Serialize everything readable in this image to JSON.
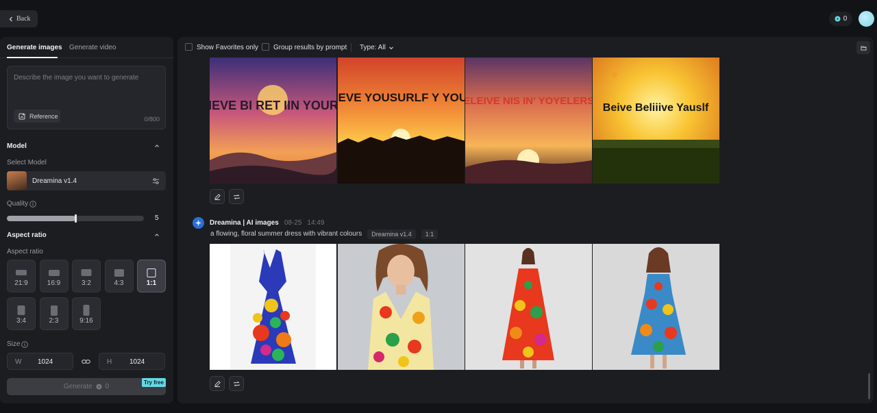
{
  "topbar": {
    "back_label": "Back",
    "credits": "0"
  },
  "left_panel": {
    "tabs": [
      {
        "label": "Generate images",
        "active": true
      },
      {
        "label": "Generate video",
        "active": false
      }
    ],
    "prompt": {
      "placeholder": "Describe the image you want to generate",
      "reference_label": "Reference",
      "char_count": "0/800"
    },
    "model": {
      "section_title": "Model",
      "select_label": "Select Model",
      "selected": "Dreamina v1.4",
      "quality_label": "Quality",
      "quality_value": "5",
      "quality_fraction": 0.5
    },
    "aspect_ratio": {
      "section_title": "Aspect ratio",
      "label": "Aspect ratio",
      "options": [
        "21:9",
        "16:9",
        "3:2",
        "4:3",
        "1:1",
        "3:4",
        "2:3",
        "9:16"
      ],
      "selected": "1:1"
    },
    "size": {
      "label": "Size",
      "w_label": "W",
      "w_value": "1024",
      "h_label": "H",
      "h_value": "1024"
    },
    "generate": {
      "label": "Generate",
      "cost": "0",
      "badge": "Try free"
    }
  },
  "main": {
    "filters": {
      "favorites_label": "Show Favorites only",
      "group_label": "Group results by prompt",
      "type_label": "Type: All"
    },
    "generations": [
      {
        "images": [
          {
            "text": "BELIEVE BI RET IIN YOURLSF"
          },
          {
            "text": "BELIEVE YOUSURLF Y YOURLF"
          },
          {
            "text": "BELEIVE NIS IN' YOYELERSF"
          },
          {
            "text": "Beive Beliiive Yauslf"
          }
        ]
      },
      {
        "author": "Dreamina | AI images",
        "date": "08-25",
        "time": "14:49",
        "prompt": "a flowing, floral summer dress with vibrant colours",
        "model_tag": "Dreamina v1.4",
        "ratio_tag": "1:1",
        "images": [
          {
            "text": ""
          },
          {
            "text": ""
          },
          {
            "text": ""
          },
          {
            "text": ""
          }
        ]
      }
    ]
  },
  "colors": {
    "accent": "#64d8e4",
    "panel": "#1c1d21",
    "background": "#121316",
    "brand_badge": "#2a6fd6"
  },
  "icons": [
    "chevron-left-icon",
    "credit-icon",
    "reference-icon",
    "chevron-up-icon",
    "settings-sliders-icon",
    "info-icon",
    "link-icon",
    "folder-icon",
    "edit-icon",
    "regenerate-icon",
    "chevron-down-icon",
    "dreamina-logo-icon"
  ]
}
